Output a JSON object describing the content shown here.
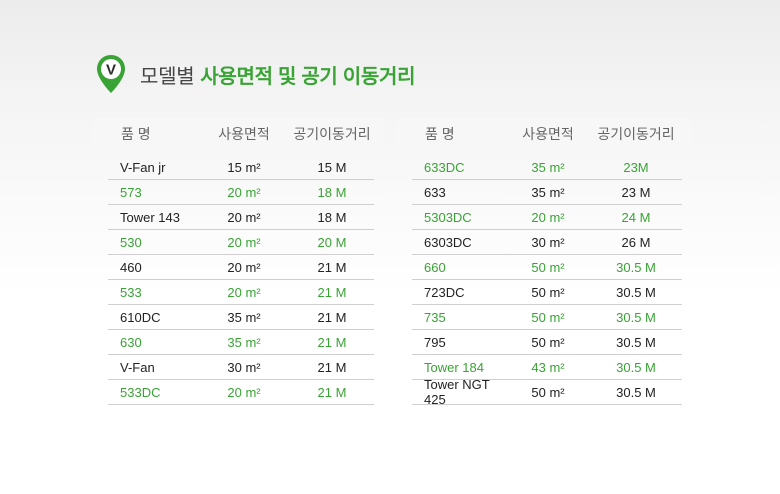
{
  "header": {
    "title_prefix": "모델별",
    "title_strong": "사용면적 및 공기 이동거리",
    "logo_letter": "V"
  },
  "columns": {
    "name": "품 명",
    "area": "사용면적",
    "distance": "공기이동거리"
  },
  "colors": {
    "accent": "#3aa335"
  },
  "left_rows": [
    {
      "name": "V-Fan jr",
      "area": "15 m²",
      "distance": "15 M",
      "highlight": false
    },
    {
      "name": "573",
      "area": "20 m²",
      "distance": "18 M",
      "highlight": true
    },
    {
      "name": "Tower 143",
      "area": "20 m²",
      "distance": "18 M",
      "highlight": false
    },
    {
      "name": "530",
      "area": "20 m²",
      "distance": "20 M",
      "highlight": true
    },
    {
      "name": "460",
      "area": "20 m²",
      "distance": "21 M",
      "highlight": false
    },
    {
      "name": "533",
      "area": "20 m²",
      "distance": "21 M",
      "highlight": true
    },
    {
      "name": "610DC",
      "area": "35 m²",
      "distance": "21 M",
      "highlight": false
    },
    {
      "name": "630",
      "area": "35 m²",
      "distance": "21 M",
      "highlight": true
    },
    {
      "name": "V-Fan",
      "area": "30 m²",
      "distance": "21 M",
      "highlight": false
    },
    {
      "name": "533DC",
      "area": "20 m²",
      "distance": "21 M",
      "highlight": true
    }
  ],
  "right_rows": [
    {
      "name": "633DC",
      "area": "35 m²",
      "distance": "23M",
      "highlight": true
    },
    {
      "name": "633",
      "area": "35 m²",
      "distance": "23 M",
      "highlight": false
    },
    {
      "name": "5303DC",
      "area": "20 m²",
      "distance": "24 M",
      "highlight": true
    },
    {
      "name": "6303DC",
      "area": "30 m²",
      "distance": "26 M",
      "highlight": false
    },
    {
      "name": "660",
      "area": "50 m²",
      "distance": "30.5 M",
      "highlight": true
    },
    {
      "name": "723DC",
      "area": "50 m²",
      "distance": "30.5 M",
      "highlight": false
    },
    {
      "name": "735",
      "area": "50 m²",
      "distance": "30.5 M",
      "highlight": true
    },
    {
      "name": "795",
      "area": "50 m²",
      "distance": "30.5 M",
      "highlight": false
    },
    {
      "name": "Tower 184",
      "area": "43 m²",
      "distance": "30.5 M",
      "highlight": true
    },
    {
      "name": "Tower NGT 425",
      "area": "50 m²",
      "distance": "30.5 M",
      "highlight": false
    }
  ]
}
